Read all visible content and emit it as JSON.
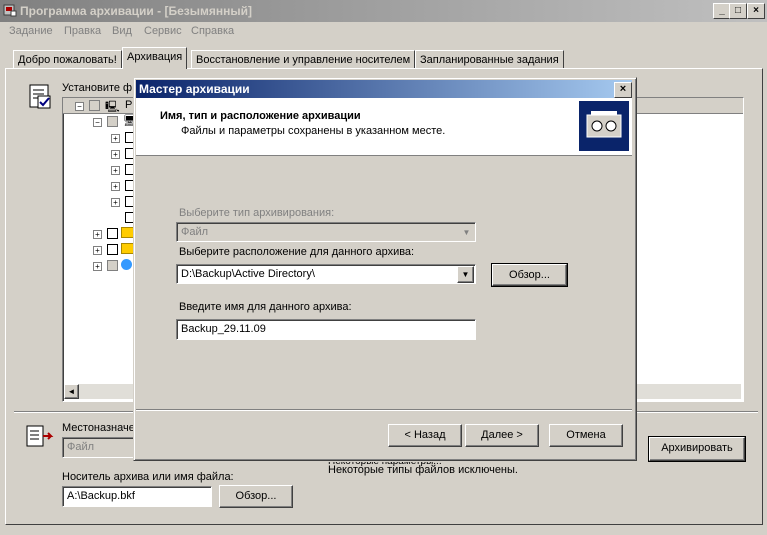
{
  "app": {
    "title": "Программа архивации - [Безымянный]",
    "window_controls": [
      "_",
      "□",
      "×"
    ]
  },
  "menu": [
    "Задание",
    "Правка",
    "Вид",
    "Сервис",
    "Справка"
  ],
  "tabs": [
    {
      "label": "Добро пожаловать!",
      "active": false
    },
    {
      "label": "Архивация",
      "active": true
    },
    {
      "label": "Восстановление и управление носителем",
      "active": false
    },
    {
      "label": "Запланированные задания",
      "active": false
    }
  ],
  "backup_tab": {
    "select_label": "Установите ф",
    "tree_root_label": "Р",
    "destination_label": "Местоназначе",
    "destination_value": "Файл",
    "media_label": "Носитель архива или имя файла:",
    "media_value": "A:\\Backup.bkf",
    "browse_label": "Обзор...",
    "status_text_cut": "Некоторые параметры...",
    "status_text": "Некоторые типы файлов исключены.",
    "start_backup_label": "Архивировать"
  },
  "wizard": {
    "title": "Мастер архивации",
    "close": "×",
    "heading": "Имя, тип и расположение архивации",
    "subheading": "Файлы и параметры сохранены в указанном месте.",
    "type_label": "Выберите тип архивирования:",
    "type_value": "Файл",
    "location_label": "Выберите расположение для данного архива:",
    "location_value": "D:\\Backup\\Active Directory\\",
    "browse_label": "Обзор...",
    "name_label": "Введите имя для данного архива:",
    "name_value": "Backup_29.11.09",
    "back_label": "< Назад",
    "next_label": "Далее >",
    "cancel_label": "Отмена"
  }
}
